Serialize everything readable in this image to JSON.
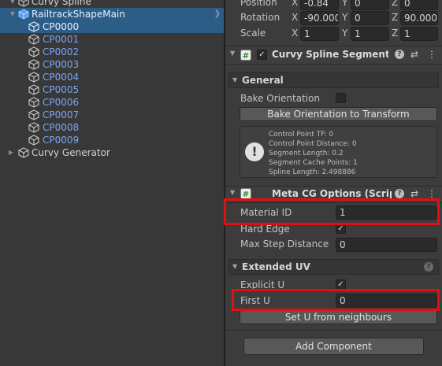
{
  "hierarchy": {
    "root_partial": "Curvy Spline",
    "selected_parent": "RailtrackShapeMain",
    "children": [
      "CP0000",
      "CP0001",
      "CP0002",
      "CP0003",
      "CP0004",
      "CP0005",
      "CP0006",
      "CP0007",
      "CP0008",
      "CP0009"
    ],
    "generator": "Curvy Generator"
  },
  "transform": {
    "position_label": "Position",
    "position": {
      "x": "-0.84",
      "y": "0",
      "z": "0"
    },
    "rotation_label": "Rotation",
    "rotation": {
      "x": "-90.000",
      "y": "0",
      "z": "90.000"
    },
    "scale_label": "Scale",
    "scale": {
      "x": "1",
      "y": "1",
      "z": "1"
    },
    "axes": {
      "x": "X",
      "y": "Y",
      "z": "Z"
    }
  },
  "segment": {
    "title": "Curvy Spline Segment (Sc",
    "general_label": "General",
    "bake_orientation_label": "Bake Orientation",
    "bake_button": "Bake Orientation to Transform",
    "info": [
      "Control Point TF: 0",
      "Control Point Distance: 0",
      "Segment Length: 0.2",
      "Segment Cache Points: 1",
      "Spline Length: 2.498886"
    ]
  },
  "meta": {
    "title": "Meta CG Options (Script)",
    "material_id_label": "Material ID",
    "material_id": "1",
    "hard_edge_label": "Hard Edge",
    "max_step_label": "Max Step Distance",
    "max_step": "0",
    "extended_uv_label": "Extended UV",
    "explicit_u_label": "Explicit U",
    "first_u_label": "First U",
    "first_u": "0",
    "set_u_button": "Set U from neighbours"
  },
  "add_component": "Add Component",
  "icons": {
    "checkmark": "✓",
    "help": "?",
    "settings": "⇄",
    "menu": "⋮",
    "info": "!"
  }
}
